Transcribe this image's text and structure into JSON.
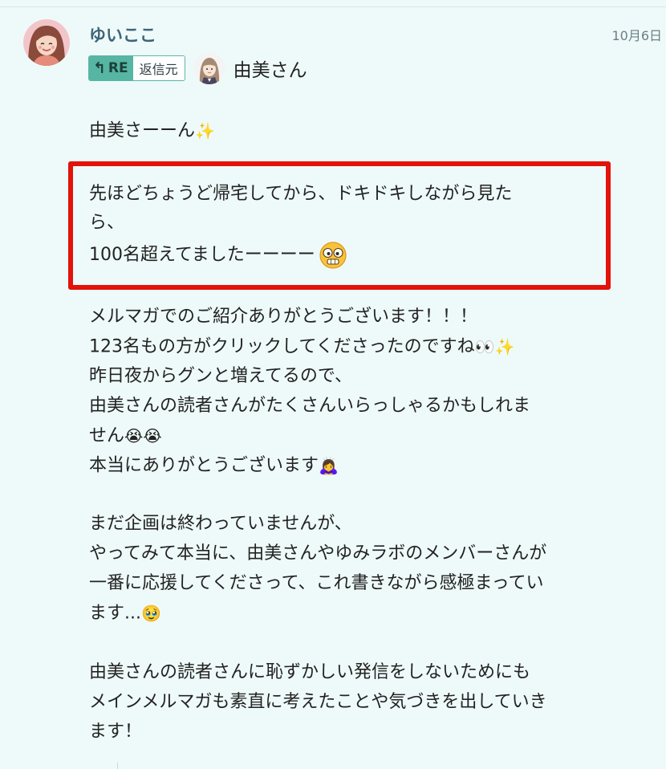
{
  "message": {
    "author": "ゆいここ",
    "date": "10月6日",
    "reply": {
      "badge_label": "RE",
      "source_label": "返信元",
      "target_name": "由美さん"
    },
    "lines": {
      "l1": "由美さーーん",
      "l2": "先ほどちょうど帰宅してから、ドキドキしながら見た",
      "l3": "ら、",
      "l4": "100名超えてましたーーーー",
      "l5": "メルマガでのご紹介ありがとうございます！！！",
      "l6": "123名もの方がクリックしてくださったのですね",
      "l7": "昨日夜からグンと増えてるので、",
      "l8": "由美さんの読者さんがたくさんいらっしゃるかもしれま",
      "l9": "せん",
      "l10": "本当にありがとうございます",
      "l11": "まだ企画は終わっていませんが、",
      "l12": "やってみて本当に、由美さんやゆみラボのメンバーさんが",
      "l13": "一番に応援してくださって、これ書きながら感極まってい",
      "l14": "ます...",
      "l15": "由美さんの読者さんに恥ずかしい発信をしないためにも",
      "l16": "メインメルマガも素直に考えたことや気づきを出していき",
      "l17": "ます！"
    },
    "emojis": {
      "sparkles": "✨",
      "eyes": "👀",
      "crying_pair": "😭😭",
      "bowing": "🙇‍♀️",
      "pleading": "🥹"
    }
  },
  "colors": {
    "background": "#eefaf9",
    "author": "#3f6478",
    "highlight_border": "#e3120b",
    "re_badge": "#56b5a3"
  },
  "icons": {
    "reply_arrow": "reply-arrow-icon",
    "surprised_face": "surprised-face-icon"
  }
}
